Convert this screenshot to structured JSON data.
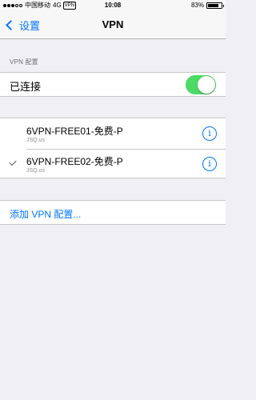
{
  "status_bar": {
    "carrier": "中国移动",
    "network": "4G",
    "vpn_badge": "VPN",
    "time": "10:08",
    "battery_percent": "83%",
    "battery_level": 0.83
  },
  "nav": {
    "back_label": "设置",
    "title": "VPN"
  },
  "vpn_config": {
    "section_header": "VPN 配置",
    "status_label": "已连接",
    "toggle_on": true
  },
  "vpn_list": [
    {
      "name": "6VPN-FREE01-免费-P",
      "server": "JSQ.us",
      "selected": false
    },
    {
      "name": "6VPN-FREE02-免费-P",
      "server": "JSQ.us",
      "selected": true
    }
  ],
  "add_config_label": "添加 VPN 配置...",
  "colors": {
    "accent": "#0076ff",
    "toggle_on": "#4cd964",
    "background": "#efeff4"
  },
  "icons": {
    "back": "chevron-left-icon",
    "info": "info-icon",
    "check": "checkmark-icon"
  }
}
